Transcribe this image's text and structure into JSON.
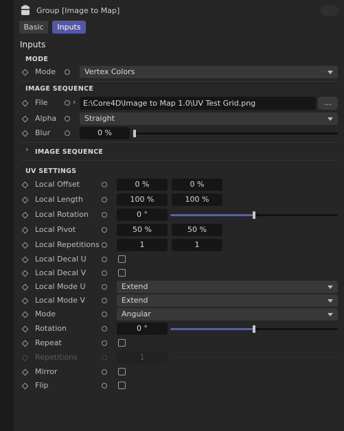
{
  "header": {
    "title": "Group [Image to Map]"
  },
  "tabs": [
    {
      "label": "Basic"
    },
    {
      "label": "Inputs"
    }
  ],
  "section_title": "Inputs",
  "mode_group": {
    "label": "MODE",
    "mode": {
      "label": "Mode",
      "value": "Vertex Colors"
    }
  },
  "image_sequence_group": {
    "label": "IMAGE SEQUENCE",
    "file": {
      "label": "File",
      "value": "E:\\Core4D\\Image to Map 1.0\\UV Test Grid.png",
      "browse_label": "..."
    },
    "alpha": {
      "label": "Alpha",
      "value": "Straight"
    },
    "blur": {
      "label": "Blur",
      "value": "0 %",
      "fraction": 0.0
    }
  },
  "collapsed_group": {
    "label": "IMAGE SEQUENCE"
  },
  "uv_group": {
    "label": "UV SETTINGS",
    "local_offset": {
      "label": "Local Offset",
      "u": "0 %",
      "v": "0 %"
    },
    "local_length": {
      "label": "Local Length",
      "u": "100 %",
      "v": "100 %"
    },
    "local_rotation": {
      "label": "Local Rotation",
      "value": "0 °",
      "fraction": 0.5
    },
    "local_pivot": {
      "label": "Local Pivot",
      "u": "50 %",
      "v": "50 %"
    },
    "local_repetitions": {
      "label": "Local Repetitions",
      "u": "1",
      "v": "1"
    },
    "local_decal_u": {
      "label": "Local Decal U",
      "checked": false
    },
    "local_decal_v": {
      "label": "Local Decal V",
      "checked": false
    },
    "local_mode_u": {
      "label": "Local Mode U",
      "value": "Extend"
    },
    "local_mode_v": {
      "label": "Local Mode V",
      "value": "Extend"
    },
    "mode": {
      "label": "Mode",
      "value": "Angular"
    },
    "rotation": {
      "label": "Rotation",
      "value": "0 °",
      "fraction": 0.5
    },
    "repeat": {
      "label": "Repeat",
      "checked": false
    },
    "repetitions": {
      "label": "Repetitions",
      "value": "1",
      "disabled": true
    },
    "mirror": {
      "label": "Mirror",
      "checked": false
    },
    "flip": {
      "label": "Flip",
      "checked": false
    }
  },
  "colors": {
    "accent": "#5558a4",
    "slider_fill": "#5a5ea8"
  }
}
